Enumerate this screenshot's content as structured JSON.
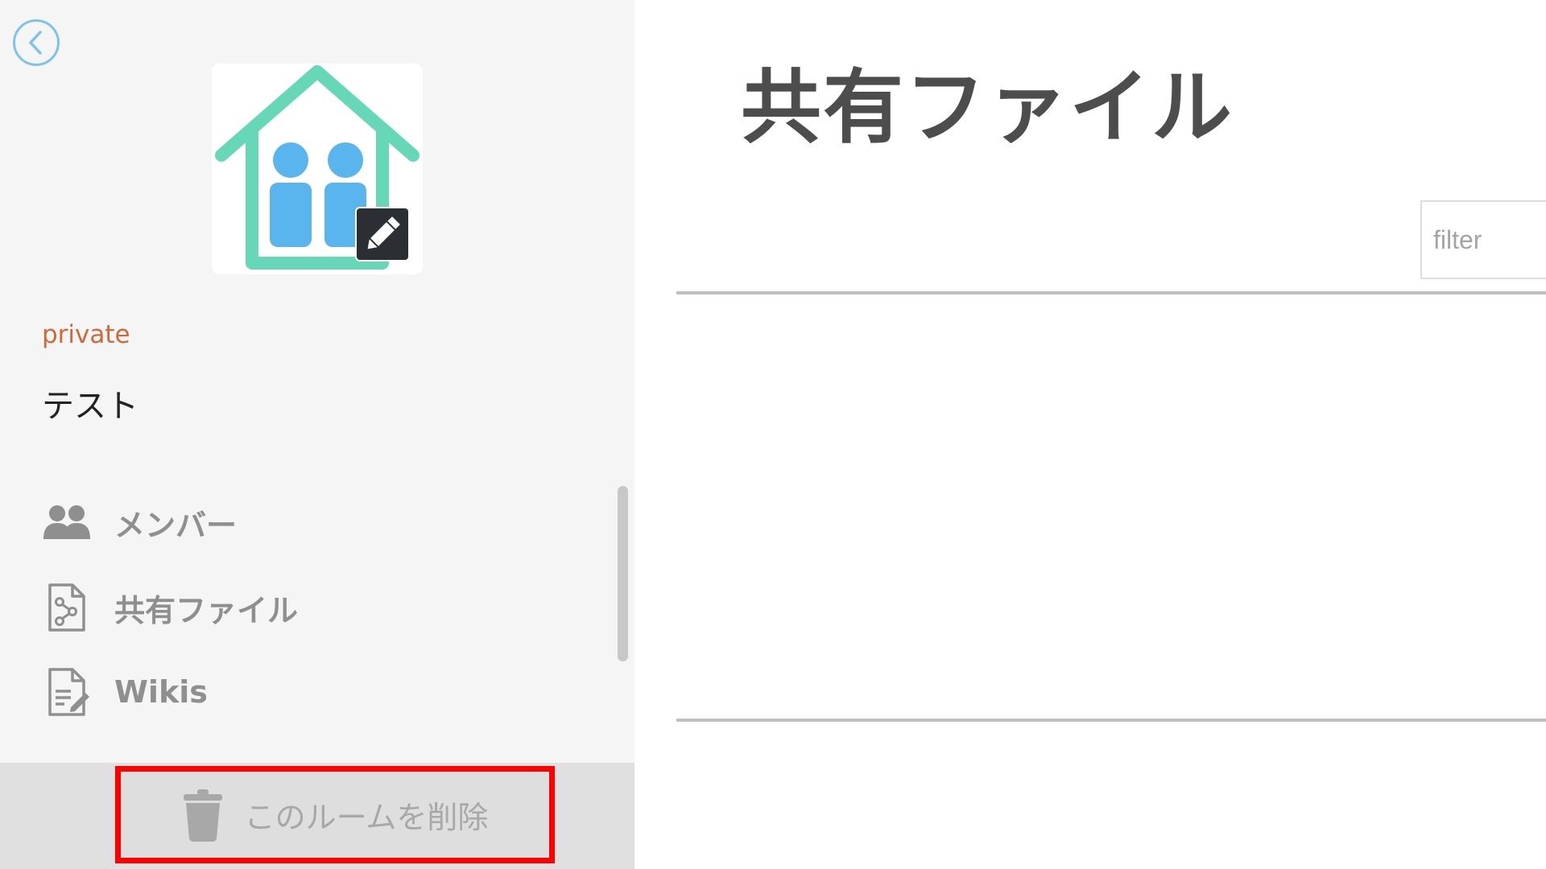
{
  "sidebar": {
    "room": {
      "visibility": "private",
      "name": "テスト"
    },
    "nav": [
      {
        "label": "メンバー",
        "icon": "users-icon"
      },
      {
        "label": "共有ファイル",
        "icon": "shared-file-icon"
      },
      {
        "label": "Wikis",
        "icon": "document-edit-icon"
      }
    ],
    "delete_button": {
      "label": "このルームを削除",
      "icon": "trash-icon"
    }
  },
  "main": {
    "title": "共有ファイル",
    "filter": {
      "placeholder": "filter",
      "value": ""
    }
  },
  "colors": {
    "sidebar_bg": "#f5f5f5",
    "visibility_text": "#cd6a3a",
    "nav_text": "#8f8f8f",
    "title_text": "#4d4d4d",
    "back_button": "#7ec3ee",
    "house_green": "#66d8b7",
    "people_blue": "#5ab4ee",
    "delete_highlight": "#ff0000"
  }
}
